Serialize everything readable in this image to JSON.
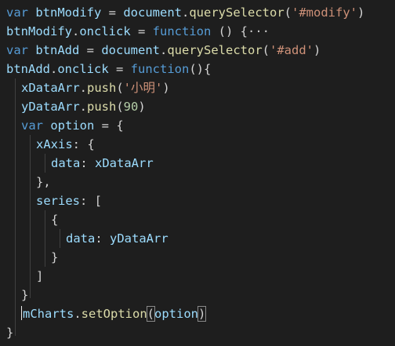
{
  "code": {
    "l1": {
      "kw": "var",
      "name": "btnModify",
      "eq": " = ",
      "obj": "document",
      "dot": ".",
      "method": "querySelector",
      "open": "(",
      "arg": "'#modify'",
      "close": ")"
    },
    "l2": {
      "obj": "btnModify",
      "dot": ".",
      "prop": "onclick",
      "eq": " = ",
      "kw": "function",
      "rest": " () {",
      "fold": "···"
    },
    "l3": {
      "kw": "var",
      "name": "btnAdd",
      "eq": " = ",
      "obj": "document",
      "dot": ".",
      "method": "querySelector",
      "open": "(",
      "arg": "'#add'",
      "close": ")"
    },
    "l4": {
      "obj": "btnAdd",
      "dot": ".",
      "prop": "onclick",
      "eq": " = ",
      "kw": "function",
      "rest": "(){"
    },
    "l5": {
      "obj": "xDataArr",
      "dot": ".",
      "method": "push",
      "open": "(",
      "arg": "'小明'",
      "close": ")"
    },
    "l6": {
      "obj": "yDataArr",
      "dot": ".",
      "method": "push",
      "open": "(",
      "arg": "90",
      "close": ")"
    },
    "l7": {
      "kw": "var",
      "name": "option",
      "rest": " = {"
    },
    "l8": {
      "key": "xAxis",
      "rest": ": {"
    },
    "l9": {
      "key": "data",
      "colon": ": ",
      "val": "xDataArr"
    },
    "l10": {
      "text": "},"
    },
    "l11": {
      "key": "series",
      "rest": ": ["
    },
    "l12": {
      "text": "{"
    },
    "l13": {
      "key": "data",
      "colon": ": ",
      "val": "yDataArr"
    },
    "l14": {
      "text": "}"
    },
    "l15": {
      "text": "]"
    },
    "l16": {
      "text": "}"
    },
    "l17": {
      "obj": "mCharts",
      "dot": ".",
      "method": "setOption",
      "open": "(",
      "arg": "option",
      "close": ")"
    },
    "l18": {
      "text": "}"
    }
  }
}
